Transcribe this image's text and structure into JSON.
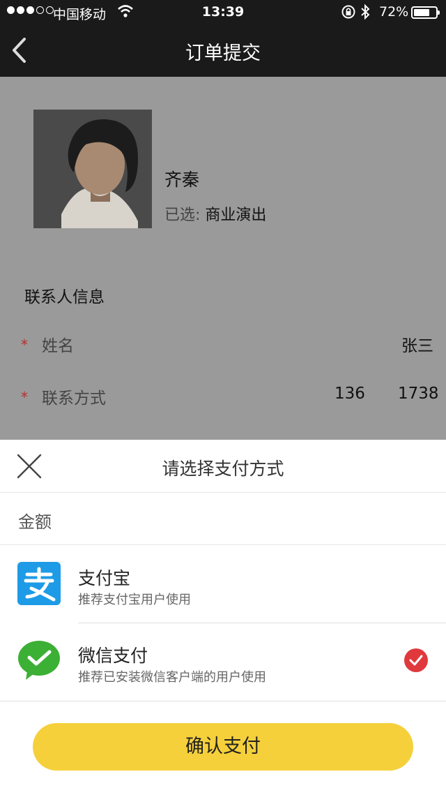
{
  "status_bar": {
    "carrier": "中国移动",
    "time": "13:39",
    "battery_percent_text": "72%",
    "battery_level": 0.72
  },
  "nav": {
    "title": "订单提交",
    "back_icon": "chevron-left-icon"
  },
  "artist": {
    "name": "齐秦",
    "selected_label": "已选:",
    "selected_value": "商业演出"
  },
  "contact": {
    "section_title": "联系人信息",
    "name_label": "姓名",
    "name_value": "张三",
    "phone_label": "联系方式",
    "phone_part1": "136",
    "phone_part2": "1738",
    "required_mark": "*"
  },
  "payment_sheet": {
    "title": "请选择支付方式",
    "close_icon": "close-icon",
    "amount_label": "金额",
    "options": [
      {
        "name": "支付宝",
        "desc": "推荐支付宝用户使用",
        "icon": "alipay-icon",
        "selected": false
      },
      {
        "name": "微信支付",
        "desc": "推荐已安装微信客户端的用户使用",
        "icon": "wechat-pay-icon",
        "selected": true
      }
    ],
    "confirm_label": "确认支付"
  },
  "colors": {
    "nav_bg": "#1a1a1a",
    "overlay_bg": "#9a9a9a",
    "alipay_blue": "#1e9be6",
    "wechat_green": "#3cb035",
    "check_red": "#e0393d",
    "button_yellow": "#f5d03b",
    "required_red": "#b23030"
  }
}
